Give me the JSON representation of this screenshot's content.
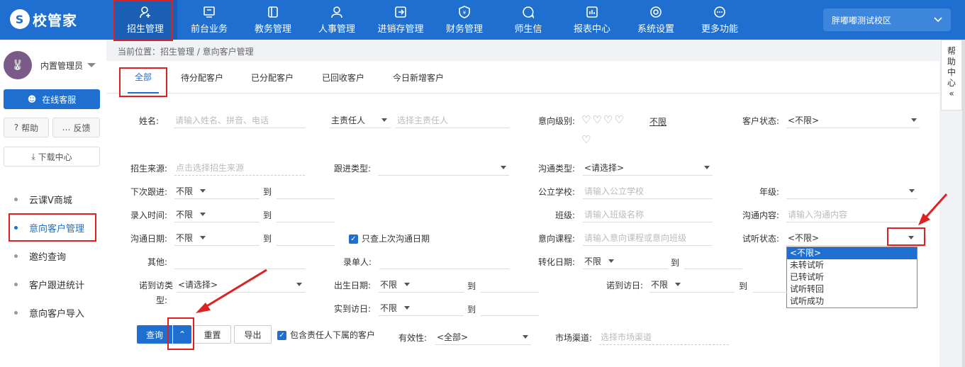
{
  "brand": {
    "name": "校管家"
  },
  "nav": [
    {
      "label": "招生管理",
      "icon": "user-add-icon"
    },
    {
      "label": "前台业务",
      "icon": "monitor-icon"
    },
    {
      "label": "教务管理",
      "icon": "book-icon"
    },
    {
      "label": "人事管理",
      "icon": "person-icon"
    },
    {
      "label": "进销存管理",
      "icon": "inventory-icon"
    },
    {
      "label": "财务管理",
      "icon": "finance-icon"
    },
    {
      "label": "师生信",
      "icon": "chat-icon"
    },
    {
      "label": "报表中心",
      "icon": "report-icon"
    },
    {
      "label": "系统设置",
      "icon": "settings-icon"
    },
    {
      "label": "更多功能",
      "icon": "more-icon"
    }
  ],
  "campus": {
    "label": "胖嘟嘟测试校区"
  },
  "sidebar": {
    "username": "内置管理员",
    "service_label": "在线客服",
    "help_label": "帮助",
    "feedback_label": "反馈",
    "download_label": "下载中心",
    "items": [
      {
        "label": "云课V商城"
      },
      {
        "label": "意向客户管理"
      },
      {
        "label": "邀约查询"
      },
      {
        "label": "客户跟进统计"
      },
      {
        "label": "意向客户导入"
      }
    ]
  },
  "breadcrumb": "当前位置：招生管理 / 意向客户管理",
  "tabs": [
    {
      "label": "全部"
    },
    {
      "label": "待分配客户"
    },
    {
      "label": "已分配客户"
    },
    {
      "label": "已回收客户"
    },
    {
      "label": "今日新增客户"
    }
  ],
  "form": {
    "name_label": "姓名:",
    "name_placeholder": "请输入姓名、拼音、电话",
    "owner_select": "主责任人",
    "owner_placeholder": "选择主责任人",
    "intent_level_label": "意向级别:",
    "hearts": "♡♡♡♡",
    "heart5": "♡",
    "unlimited_link": "不限",
    "customer_status_label": "客户状态:",
    "customer_status_value": "<不限>",
    "source_label": "招生来源:",
    "source_placeholder": "点击选择招生来源",
    "follow_type_label": "跟进类型:",
    "comm_type_label": "沟通类型:",
    "comm_type_value": "<请选择>",
    "next_follow_label": "下次跟进:",
    "unlimited": "不限",
    "to": "到",
    "public_school_label": "公立学校:",
    "public_school_placeholder": "请输入公立学校",
    "grade_label": "年级:",
    "entry_time_label": "录入时间:",
    "class_label": "班级:",
    "class_placeholder": "请输入班级名称",
    "comm_content_label": "沟通内容:",
    "comm_content_placeholder": "请输入沟通内容",
    "comm_date_label": "沟通日期:",
    "only_last_label": "只查上次沟通日期",
    "intent_course_label": "意向课程:",
    "intent_course_placeholder": "请输入意向课程或意向班级",
    "trial_status_label": "试听状态:",
    "trial_status_value": "<不限>",
    "other_label": "其他:",
    "entry_person_label": "录单人:",
    "convert_date_label": "转化日期:",
    "promise_type_label": "诺到访类",
    "promise_type_label2": "型:",
    "promise_type_value": "<请选择>",
    "birth_date_label": "出生日期:",
    "promise_visit_label": "诺到访日:",
    "actual_visit_label": "实到访日:",
    "validity_label": "有效性:",
    "validity_value": "<全部>",
    "market_label": "市场渠道:",
    "market_placeholder": "选择市场渠道",
    "include_sub_label": "包含责任人下属的客户"
  },
  "trial_dropdown": [
    "<不限>",
    "未转试听",
    "已转试听",
    "试听转回",
    "试听成功"
  ],
  "buttons": {
    "query": "查询",
    "expand": "⌃",
    "reset": "重置",
    "export": "导出"
  },
  "help_center": [
    "帮",
    "助",
    "中",
    "心",
    "«"
  ],
  "colors": {
    "primary": "#1e6fd0",
    "annotation": "#e02020"
  }
}
